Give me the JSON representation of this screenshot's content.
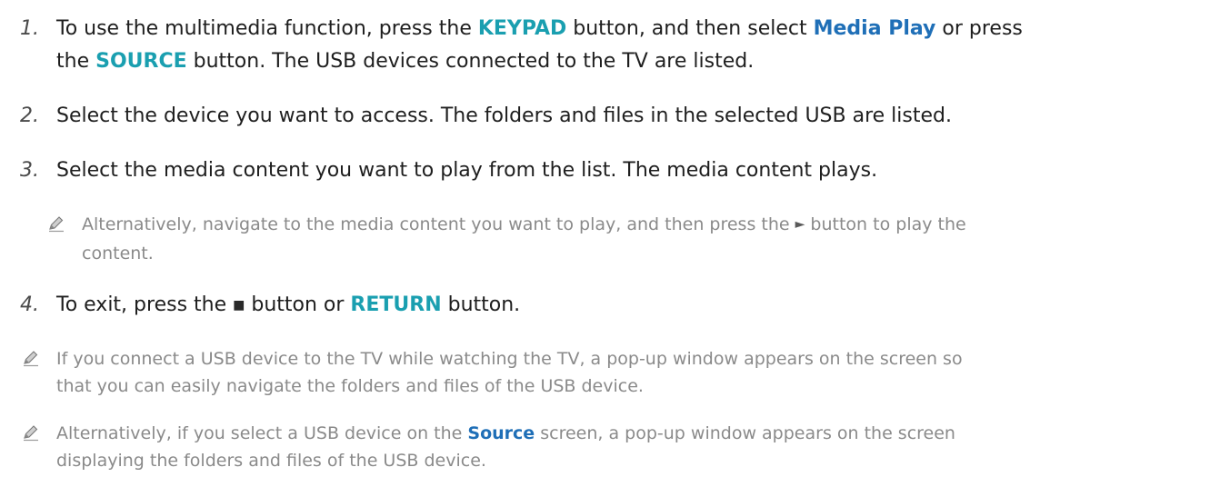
{
  "steps": [
    {
      "number": "1.",
      "line1_a": "To use the multimedia function, press the ",
      "line1_kw1": "KEYPAD",
      "line1_b": " button, and then select ",
      "line1_kw2": "Media Play",
      "line1_c": " or press",
      "line2_a": "the ",
      "line2_kw": "SOURCE",
      "line2_b": " button. The USB devices connected to the TV are listed."
    },
    {
      "number": "2.",
      "text": "Select the device you want to access. The folders and files in the selected USB are listed."
    },
    {
      "number": "3.",
      "text": "Select the media content you want to play from the list. The media content plays."
    },
    {
      "number": "4.",
      "a": "To exit, press the ",
      "symbol": "■",
      "b": " button or ",
      "kw": "RETURN",
      "c": " button."
    }
  ],
  "notes": {
    "step3_note": {
      "icon": "pencil-icon",
      "line1_a": "Alternatively, navigate to the media content you want to play, and then press the ",
      "symbol": "►",
      "line1_b": " button to play the",
      "line2": "content."
    },
    "general_note1": {
      "icon": "pencil-icon",
      "line1": "If you connect a USB device to the TV while watching the TV, a pop-up window appears on the screen so",
      "line2": "that you can easily navigate the folders and files of the USB device."
    },
    "general_note2": {
      "icon": "pencil-icon",
      "line1_a": "Alternatively, if you select a USB device on the ",
      "kw": "Source",
      "line1_b": " screen, a pop-up window appears on the screen",
      "line2": "displaying the folders and files of the USB device."
    }
  },
  "colors": {
    "keyword_teal": "#1a9fb0",
    "keyword_blue": "#1f6fb7",
    "note_gray": "#8a8a8a"
  }
}
